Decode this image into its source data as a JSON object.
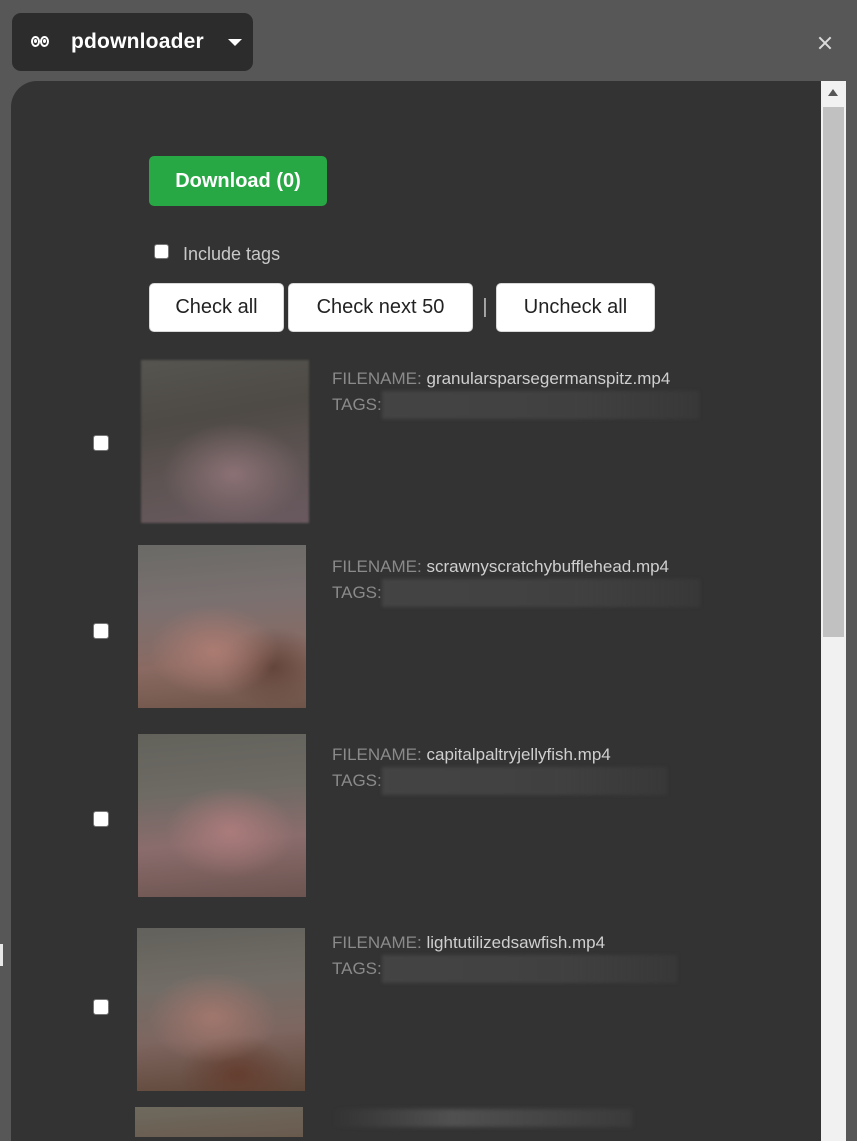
{
  "header": {
    "title": "pdownloader",
    "logo_icon": "eyes-logo-icon",
    "dropdown_icon": "caret-down-icon",
    "close_icon": "close-icon"
  },
  "actions": {
    "download_label": "Download (0)",
    "include_tags_label": "Include tags",
    "check_all_label": "Check all",
    "check_next_label": "Check next 50",
    "separator": "|",
    "uncheck_all_label": "Uncheck all"
  },
  "colors": {
    "panel_bg": "#333333",
    "download_green": "#28a745",
    "page_bg": "#575757"
  },
  "items": [
    {
      "filename_label": "FILENAME:",
      "filename": "granularsparsegermanspitz.mp4",
      "tags_label": "TAGS:",
      "checked": false
    },
    {
      "filename_label": "FILENAME:",
      "filename": "scrawnyscratchybufflehead.mp4",
      "tags_label": "TAGS:",
      "checked": false
    },
    {
      "filename_label": "FILENAME:",
      "filename": "capitalpaltryjellyfish.mp4",
      "tags_label": "TAGS:",
      "checked": false
    },
    {
      "filename_label": "FILENAME:",
      "filename": "lightutilizedsawfish.mp4",
      "tags_label": "TAGS:",
      "checked": false
    }
  ]
}
